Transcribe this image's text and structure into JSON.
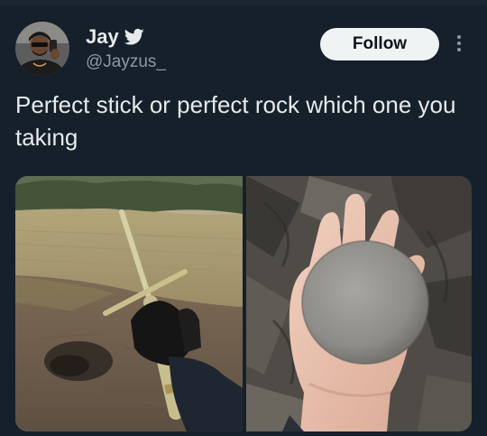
{
  "author": {
    "display_name": "Jay",
    "handle": "@Jayzus_",
    "verified_icon": "twitter-bird-icon"
  },
  "actions": {
    "follow_label": "Follow",
    "more_icon": "more-vertical-icon"
  },
  "tweet": {
    "text": "Perfect stick or perfect rock which one you taking"
  },
  "colors": {
    "background": "#15202b",
    "text": "#e7e9ea",
    "secondary_text": "#8b98a5",
    "follow_button": "#eff3f4",
    "bird": "#e7e9ea"
  }
}
